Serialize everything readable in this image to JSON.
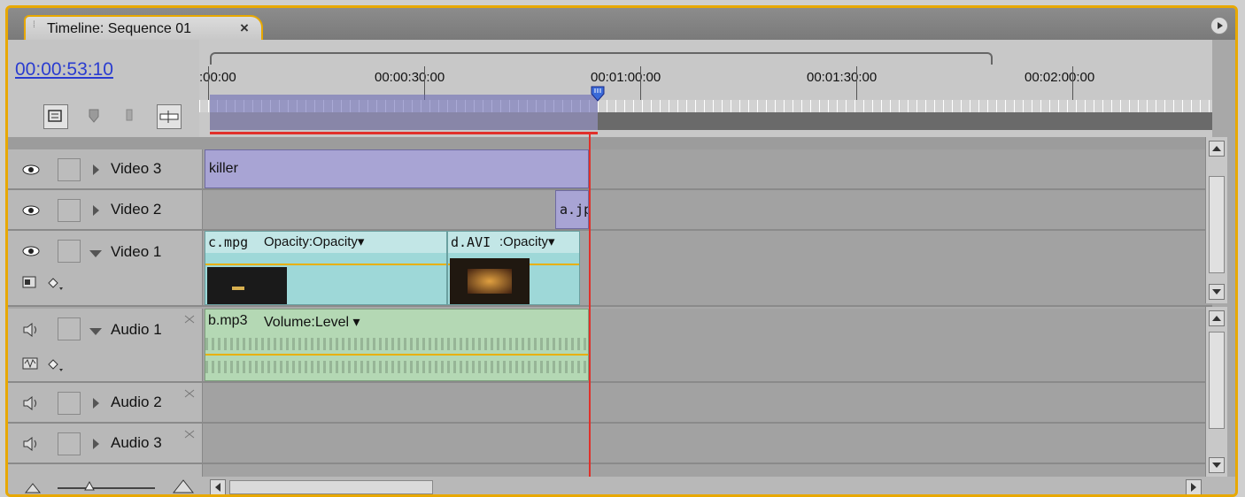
{
  "panel": {
    "tab_title": "Timeline: Sequence 01",
    "tab_close": "×"
  },
  "timeline": {
    "current_time": "00:00:53:10",
    "ruler_labels": [
      ":00:00",
      "00:00:30:00",
      "00:01:00:00",
      "00:01:30:00",
      "00:02:00:00"
    ]
  },
  "tracks": {
    "video3": {
      "name": "Video 3"
    },
    "video2": {
      "name": "Video 2"
    },
    "video1": {
      "name": "Video 1"
    },
    "audio1": {
      "name": "Audio 1"
    },
    "audio2": {
      "name": "Audio 2"
    },
    "audio3": {
      "name": "Audio 3"
    }
  },
  "clips": {
    "killer": {
      "label": "killer"
    },
    "a_jpg": {
      "label": "a.jp"
    },
    "c_mpg": {
      "label": "c.mpg",
      "effect": "Opacity:Opacity"
    },
    "d_avi": {
      "label": "d.AVI",
      "effect": ":Opacity"
    },
    "b_mp3": {
      "label": "b.mp3",
      "effect": "Volume:Level"
    }
  },
  "dropdown_glyph": "▾",
  "colors": {
    "accent_border": "#e8a800",
    "playhead": "#e0302a",
    "timecode": "#2a3cd0",
    "video_clip_purple": "#a8a4d4",
    "video_clip_teal": "#9ed8d8",
    "audio_clip_green": "#b4d8b4"
  }
}
